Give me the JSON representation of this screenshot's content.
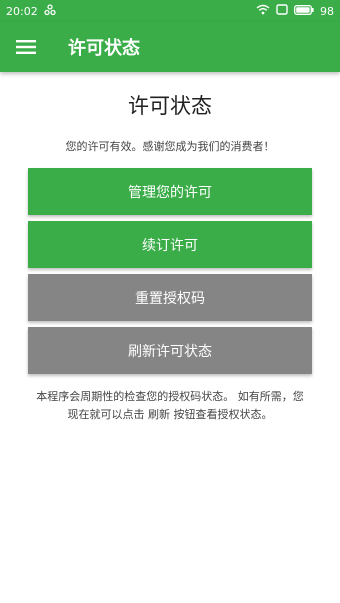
{
  "status_bar": {
    "time": "20:02",
    "battery": "98"
  },
  "app_bar": {
    "title": "许可状态",
    "menu_icon": "hamburger-menu-icon"
  },
  "main": {
    "title": "许可状态",
    "status_message": "您的许可有效。感谢您成为我们的消费者！",
    "buttons": [
      {
        "label": "管理您的许可",
        "color": "#3aad49"
      },
      {
        "label": "续订许可",
        "color": "#3aad49"
      },
      {
        "label": "重置授权码",
        "color": "#858585"
      },
      {
        "label": "刷新许可状态",
        "color": "#858585"
      }
    ],
    "description_line1": "本程序会周期性的检查您的授权码状态。 如有所需，您",
    "description_line2": "现在就可以点击 刷新 按钮查看授权状态。"
  },
  "colors": {
    "accent": "#3aad49",
    "secondary_button": "#858585"
  }
}
